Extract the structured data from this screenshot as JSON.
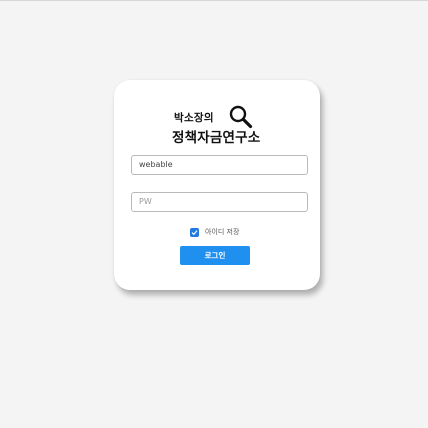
{
  "logo": {
    "line1": "박소장의",
    "line2": "정책자금연구소",
    "icon": "magnifier-icon"
  },
  "form": {
    "id_value": "webable",
    "pw_placeholder": "PW",
    "save_id_label": "아이디 저장",
    "save_id_checked": true,
    "login_label": "로그인"
  },
  "colors": {
    "accent": "#1f8ff0",
    "checkbox": "#1f7be0",
    "background": "#f4f4f4",
    "card": "#ffffff"
  }
}
